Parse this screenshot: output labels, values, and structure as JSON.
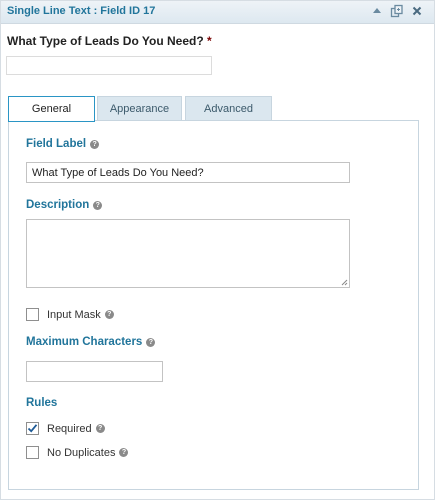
{
  "header": {
    "title": "Single Line Text : Field ID 17",
    "icons": [
      "collapse-arrow-icon",
      "duplicate-icon",
      "close-icon"
    ]
  },
  "preview": {
    "label": "What Type of Leads Do You Need?",
    "required_mark": "*"
  },
  "tabs": [
    {
      "label": "General",
      "active": true
    },
    {
      "label": "Appearance",
      "active": false
    },
    {
      "label": "Advanced",
      "active": false
    }
  ],
  "general": {
    "field_label": {
      "label": "Field Label",
      "value": "What Type of Leads Do You Need?"
    },
    "description": {
      "label": "Description",
      "value": ""
    },
    "input_mask": {
      "label": "Input Mask",
      "checked": false
    },
    "max_chars": {
      "label": "Maximum Characters",
      "value": ""
    },
    "rules": {
      "label": "Rules",
      "required": {
        "label": "Required",
        "checked": true
      },
      "no_duplicates": {
        "label": "No Duplicates",
        "checked": false
      }
    }
  },
  "colors": {
    "accent": "#21759b",
    "title_bg": "#dde8f0",
    "tab_inactive": "#dbe7ef"
  }
}
